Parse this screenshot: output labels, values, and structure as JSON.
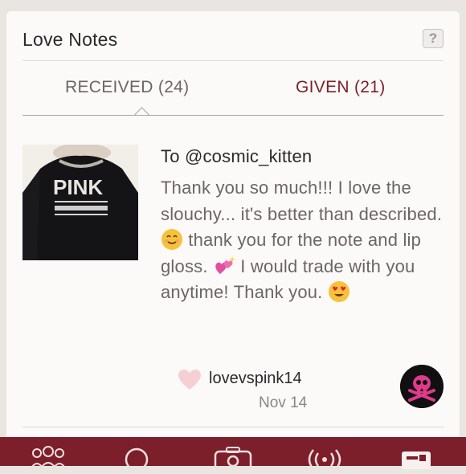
{
  "header": {
    "title": "Love Notes",
    "help_label": "?"
  },
  "tabs": [
    {
      "label": "RECEIVED",
      "count": "(24)",
      "active": true
    },
    {
      "label": "GIVEN",
      "count": "(21)",
      "active": false
    }
  ],
  "note": {
    "to_line": "To @cosmic_kitten",
    "message_parts": [
      "Thank you so much!!! I love the slouchy... it's better than described. ",
      " thank you for the note and lip gloss. ",
      " I would trade with you anytime! Thank you. "
    ],
    "emojis": [
      "smiling-face-icon",
      "sparkling-hearts-icon",
      "heart-eyes-icon"
    ],
    "thumbnail": {
      "icon": "pink-sweatshirt-image",
      "brand_text": "PINK"
    },
    "author": "lovevspink14",
    "date": "Nov 14",
    "like_icon": "heart-icon",
    "avatar_icon": "skull-crossbones-icon"
  },
  "nav": {
    "items": [
      "community-icon",
      "search-icon",
      "camera-icon",
      "broadcast-icon",
      "account-icon"
    ]
  },
  "colors": {
    "accent": "#7c1f2b",
    "tab_active": "#6c6663",
    "tab_inactive": "#7b1f2a",
    "heart": "#f6cfd3",
    "avatar_pink": "#e03a8a"
  }
}
